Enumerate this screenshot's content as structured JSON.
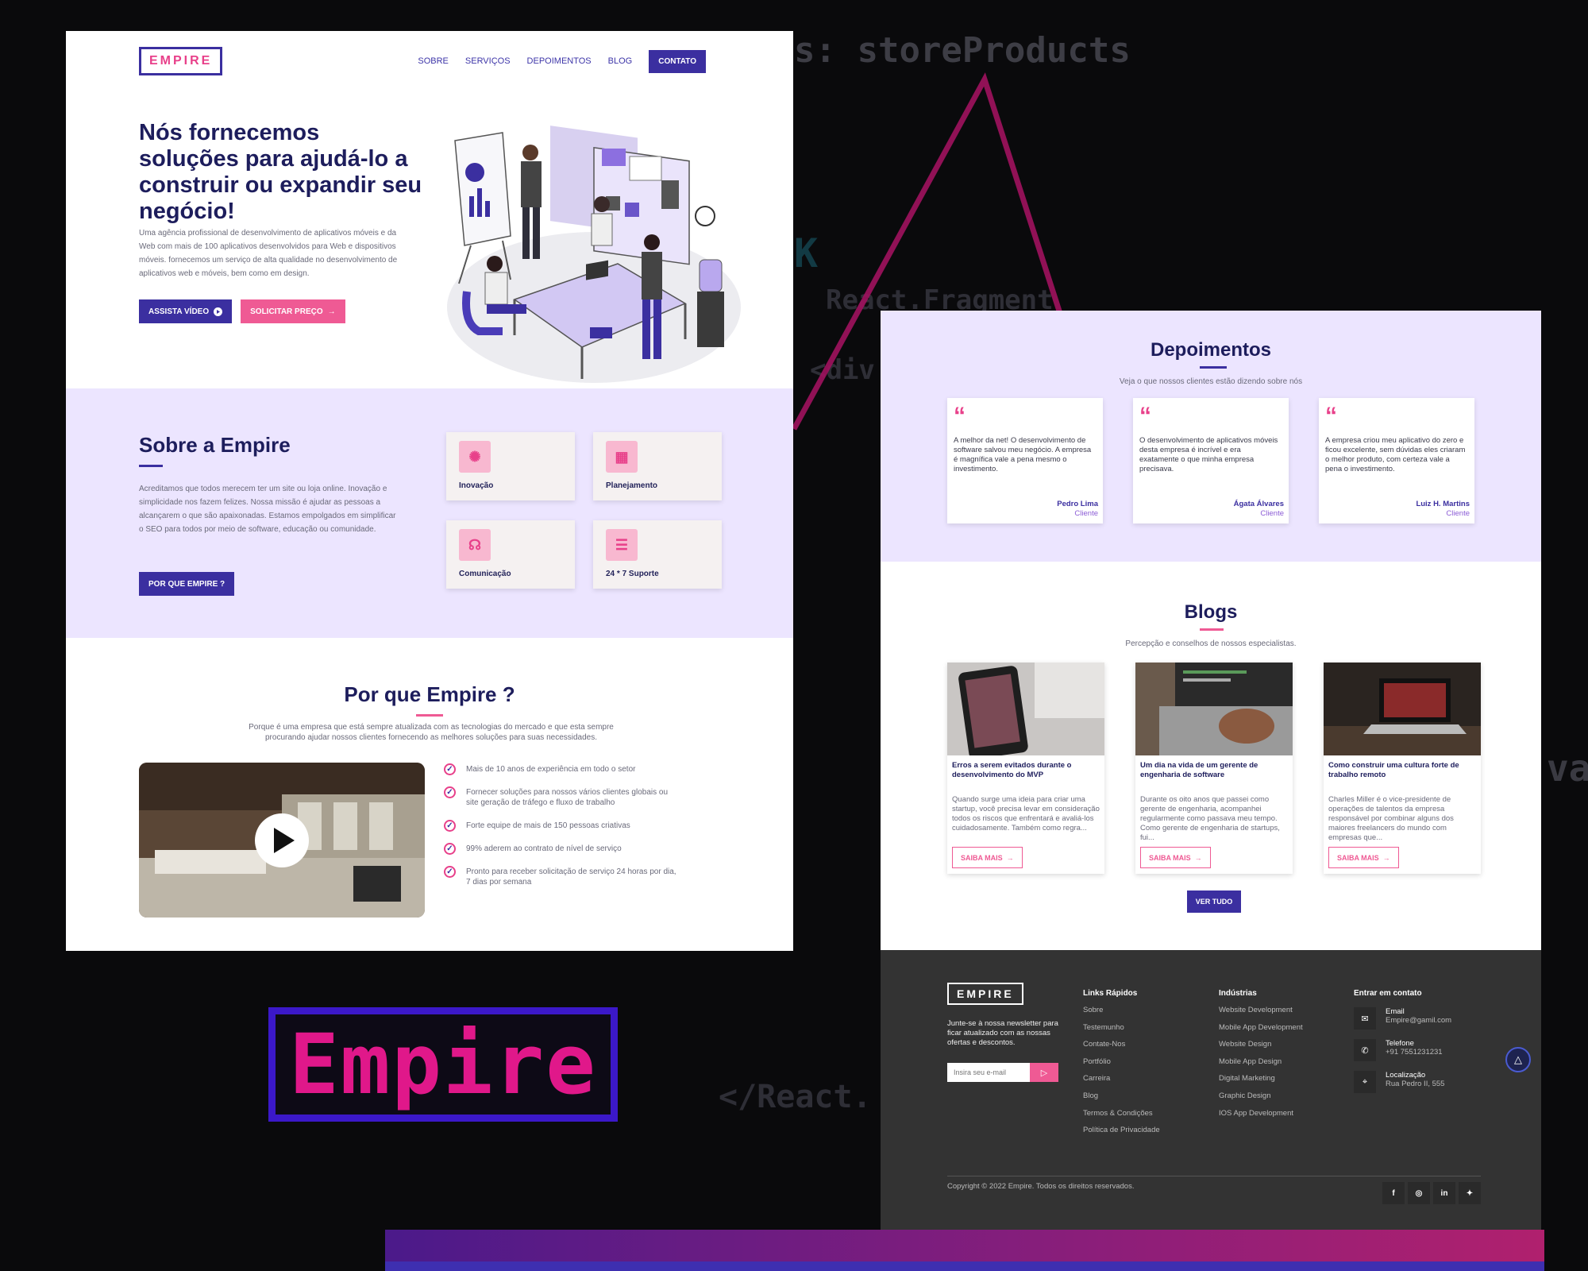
{
  "background": {
    "code_lines": [
      "s: storeProducts",
      "React.Fragment",
      "<div",
      "</React.",
      "K",
      "va"
    ]
  },
  "showcase_logo": "Empire",
  "left_page": {
    "nav": {
      "logo": "EMPIRE",
      "links": [
        "SOBRE",
        "SERVIÇOS",
        "DEPOIMENTOS",
        "BLOG"
      ],
      "contact": "CONTATO"
    },
    "hero": {
      "title": "Nós fornecemos soluções para ajudá-lo a construir ou expandir seu negócio!",
      "text": "Uma agência profissional de desenvolvimento de aplicativos móveis e da Web com mais de 100 aplicativos desenvolvidos para Web e dispositivos móveis. fornecemos um serviço de alta qualidade no desenvolvimento de aplicativos web e móveis, bem como em design.",
      "btn_video": "ASSISTA VÍDEO",
      "btn_quote": "SOLICITAR PREÇO"
    },
    "about": {
      "title": "Sobre a Empire",
      "text": "Acreditamos que todos merecem ter um site ou loja online. Inovação e simplicidade nos fazem felizes. Nossa missão é ajudar as pessoas a alcançarem o que são apaixonadas. Estamos empolgados em simplificar o SEO para todos por meio de software, educação ou comunidade.",
      "button": "POR QUE EMPIRE ?",
      "features": [
        {
          "label": "Inovação",
          "icon": "lightbulb-icon"
        },
        {
          "label": "Planejamento",
          "icon": "calendar-icon"
        },
        {
          "label": "Comunicação",
          "icon": "headset-icon"
        },
        {
          "label": "24 * 7 Suporte",
          "icon": "chat-icon"
        }
      ]
    },
    "why": {
      "title": "Por que Empire ?",
      "subtitle": "Porque é uma empresa que está sempre atualizada com as tecnologias do mercado e que esta sempre procurando ajudar nossos clientes fornecendo as melhores soluções para suas necessidades.",
      "items": [
        "Mais de 10 anos de experiência em todo o setor",
        "Fornecer soluções para nossos vários clientes globais ou site geração de tráfego e fluxo de trabalho",
        "Forte equipe de mais de 150 pessoas criativas",
        "99% aderem ao contrato de nível de serviço",
        "Pronto para receber solicitação de serviço 24 horas por dia, 7 dias por semana"
      ]
    }
  },
  "right_page": {
    "testimonials": {
      "title": "Depoimentos",
      "subtitle": "Veja o que nossos clientes estão dizendo sobre nós",
      "items": [
        {
          "text": "A melhor da net! O desenvolvimento de software salvou meu negócio. A empresa é magnífica vale a pena mesmo o investimento.",
          "name": "Pedro Lima",
          "role": "Cliente"
        },
        {
          "text": "O desenvolvimento de aplicativos móveis desta empresa é incrível e era exatamente o que minha empresa precisava.",
          "name": "Ágata Álvares",
          "role": "Cliente"
        },
        {
          "text": "A empresa criou meu aplicativo do zero e ficou excelente, sem dúvidas eles criaram o melhor produto, com certeza vale a pena o investimento.",
          "name": "Luiz H. Martins",
          "role": "Cliente"
        }
      ]
    },
    "blogs": {
      "title": "Blogs",
      "subtitle": "Percepção e conselhos de nossos especialistas.",
      "items": [
        {
          "title": "Erros a serem evitados durante o desenvolvimento do MVP",
          "text": "Quando surge uma ideia para criar uma startup, você precisa levar em consideração todos os riscos que enfrentará e avaliá-los cuidadosamente. Também como regra...",
          "more": "SAIBA MAIS"
        },
        {
          "title": "Um dia na vida de um gerente de engenharia de software",
          "text": "Durante os oito anos que passei como gerente de engenharia, acompanhei regularmente como passava meu tempo. Como gerente de engenharia de startups, fui...",
          "more": "SAIBA MAIS"
        },
        {
          "title": "Como construir uma cultura forte de trabalho remoto",
          "text": "Charles Miller é o vice-presidente de operações de talentos da empresa responsável por combinar alguns dos maiores freelancers do mundo com empresas que...",
          "more": "SAIBA MAIS"
        }
      ],
      "see_all": "VER TUDO"
    },
    "footer": {
      "logo": "EMPIRE",
      "newsletter": "Junte-se à nossa newsletter para ficar atualizado com as nossas ofertas e descontos.",
      "email_placeholder": "Insira seu e-mail",
      "quick_links_title": "Links Rápidos",
      "quick_links": [
        "Sobre",
        "Testemunho",
        "Contate-Nos",
        "Portfólio",
        "Carreira",
        "Blog",
        "Termos & Condições",
        "Política de Privacidade"
      ],
      "industries_title": "Indústrias",
      "industries": [
        "Website Development",
        "Mobile App Development",
        "Website Design",
        "Mobile App Design",
        "Digital Marketing",
        "Graphic Design",
        "IOS App Development"
      ],
      "contact_title": "Entrar em contato",
      "contact": [
        {
          "label": "Email",
          "value": "Empire@gamil.com",
          "icon": "mail-icon"
        },
        {
          "label": "Telefone",
          "value": "+91 7551231231",
          "icon": "phone-icon"
        },
        {
          "label": "Localização",
          "value": "Rua Pedro II, 555",
          "icon": "location-icon"
        }
      ],
      "copyright": "Copyright © 2022 Empire. Todos os direitos reservados.",
      "social": [
        "facebook-icon",
        "instagram-icon",
        "linkedin-icon",
        "twitter-icon"
      ]
    }
  },
  "colors": {
    "brand_dark": "#3b2fa0",
    "brand_pink": "#ef5a94",
    "lavender": "#ece5ff",
    "footer": "#333333"
  }
}
